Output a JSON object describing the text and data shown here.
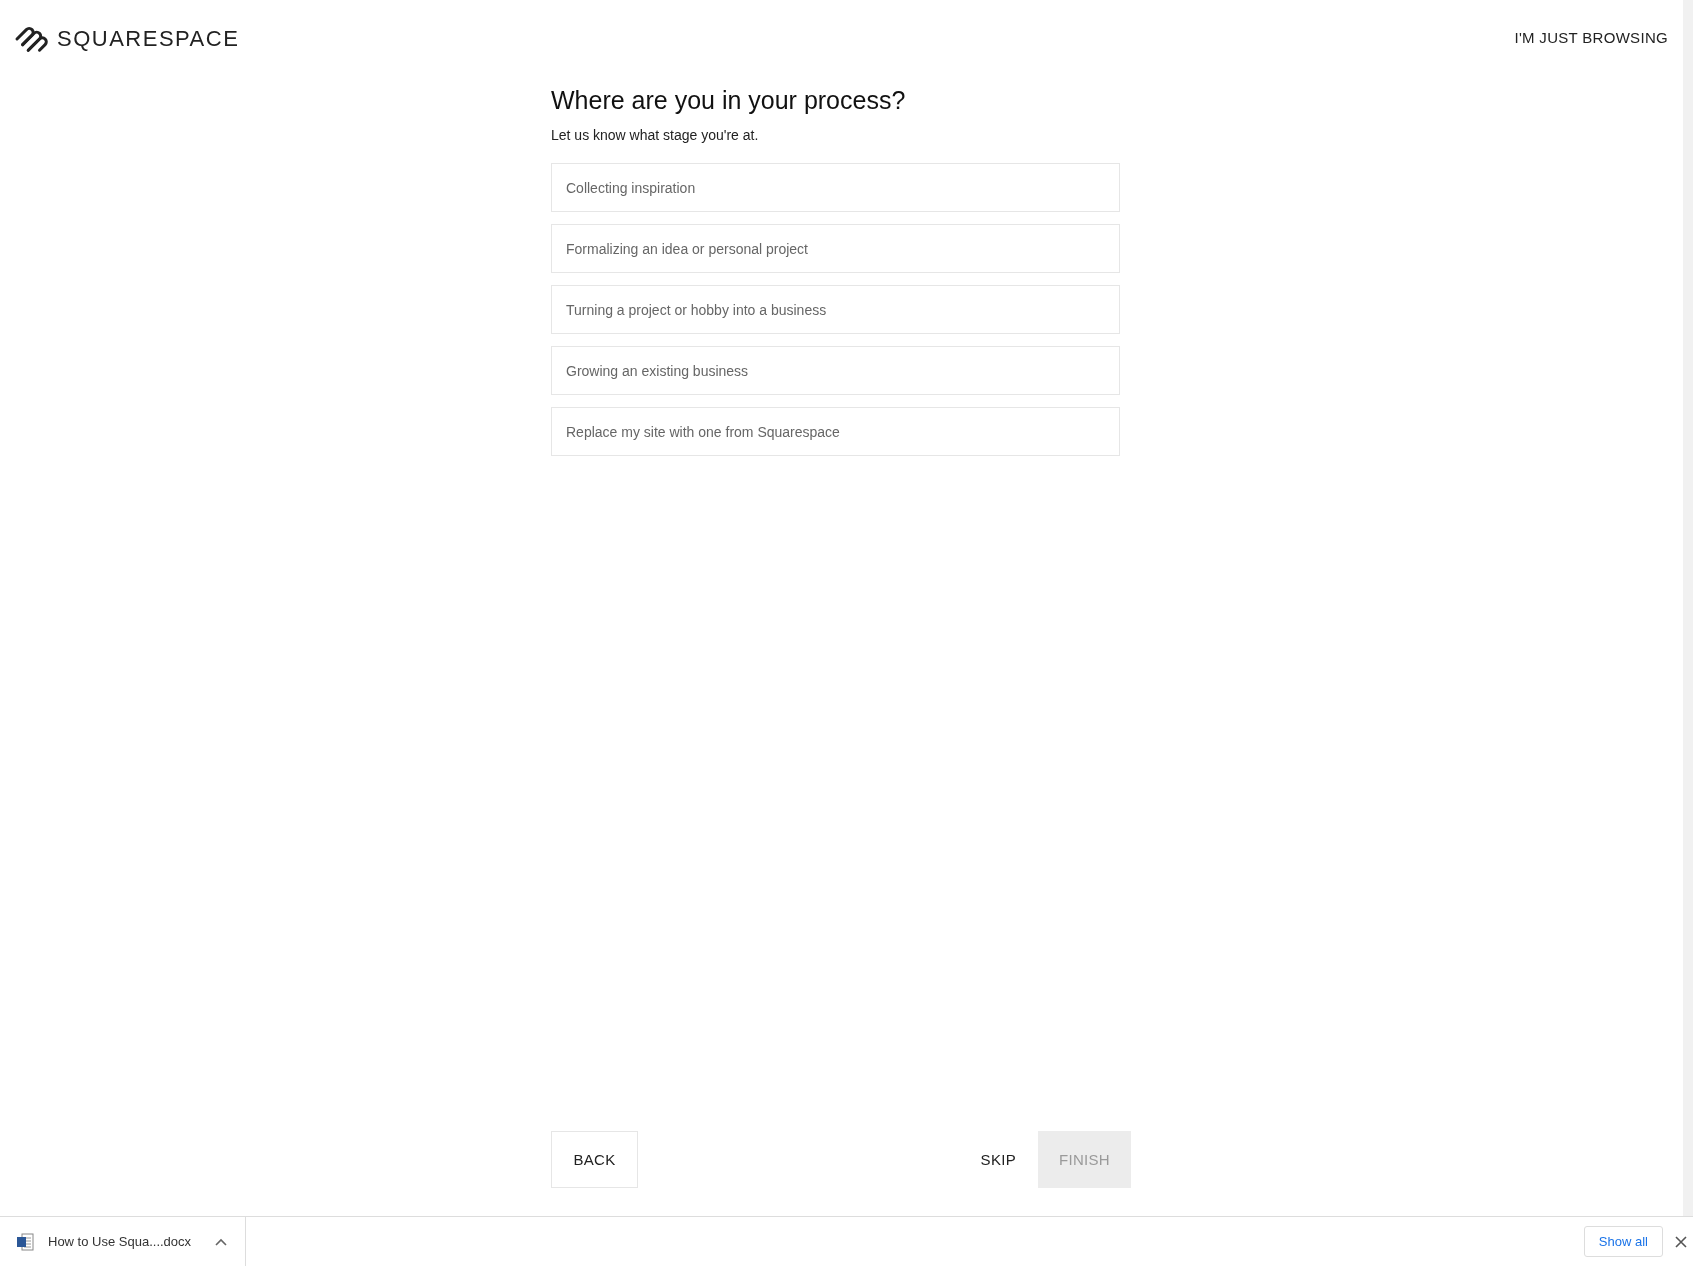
{
  "header": {
    "logo_text": "SQUARESPACE",
    "browse_link": "I'M JUST BROWSING"
  },
  "question": {
    "title": "Where are you in your process?",
    "subtitle": "Let us know what stage you're at.",
    "options": [
      {
        "label": "Collecting inspiration",
        "selected": false
      },
      {
        "label": "Formalizing an idea or personal project",
        "selected": false
      },
      {
        "label": "Turning a project or hobby into a business",
        "selected": false
      },
      {
        "label": "Growing an existing business",
        "selected": false
      },
      {
        "label": "Replace my site with one from Squarespace",
        "selected": false
      }
    ]
  },
  "footer": {
    "back": "BACK",
    "skip": "SKIP",
    "finish": {
      "label": "FINISH",
      "disabled": true
    }
  },
  "download_bar": {
    "file": "How to Use Squa....docx",
    "show_all": "Show all"
  }
}
